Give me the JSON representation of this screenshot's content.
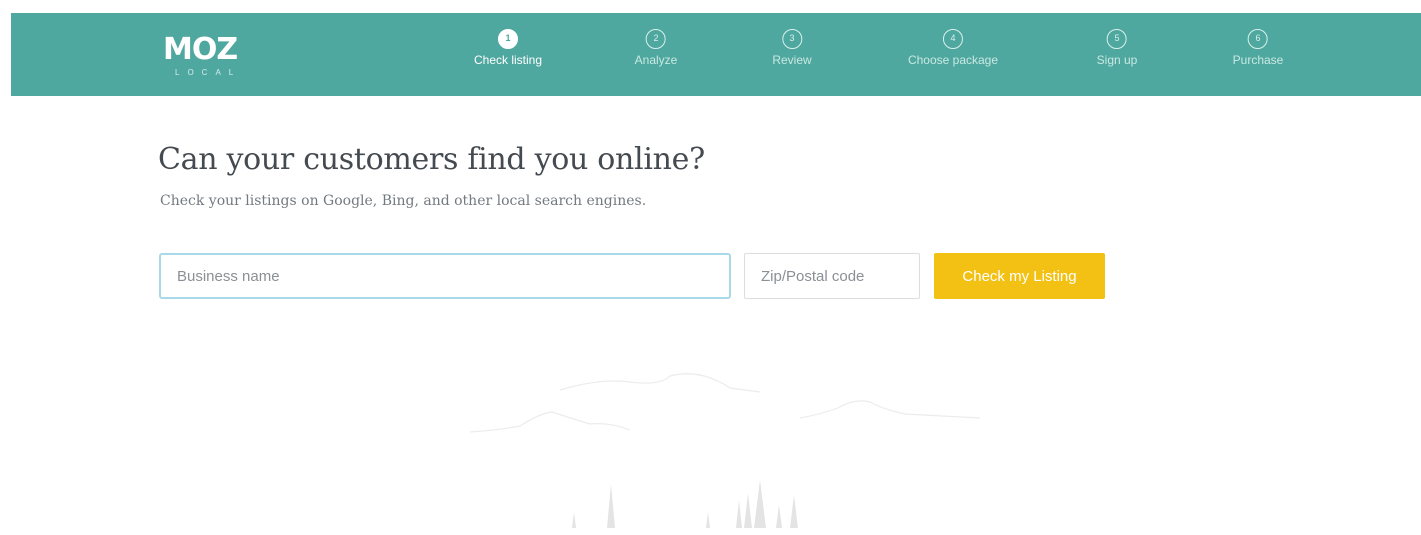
{
  "header": {
    "logo": {
      "brand": "MOZ",
      "product": "LOCAL"
    },
    "steps": [
      {
        "number": "1",
        "label": "Check listing",
        "active": true
      },
      {
        "number": "2",
        "label": "Analyze",
        "active": false
      },
      {
        "number": "3",
        "label": "Review",
        "active": false
      },
      {
        "number": "4",
        "label": "Choose package",
        "active": false
      },
      {
        "number": "5",
        "label": "Sign up",
        "active": false
      },
      {
        "number": "6",
        "label": "Purchase",
        "active": false
      }
    ]
  },
  "main": {
    "headline": "Can your customers find you online?",
    "subline": "Check your listings on Google, Bing, and other local search engines.",
    "form": {
      "business_placeholder": "Business name",
      "business_value": "",
      "zip_placeholder": "Zip/Postal code",
      "zip_value": "",
      "submit_label": "Check my Listing"
    }
  },
  "colors": {
    "header_bg": "#4fa89f",
    "button_bg": "#f2c114",
    "input_focus_border": "#a9d8e6"
  }
}
